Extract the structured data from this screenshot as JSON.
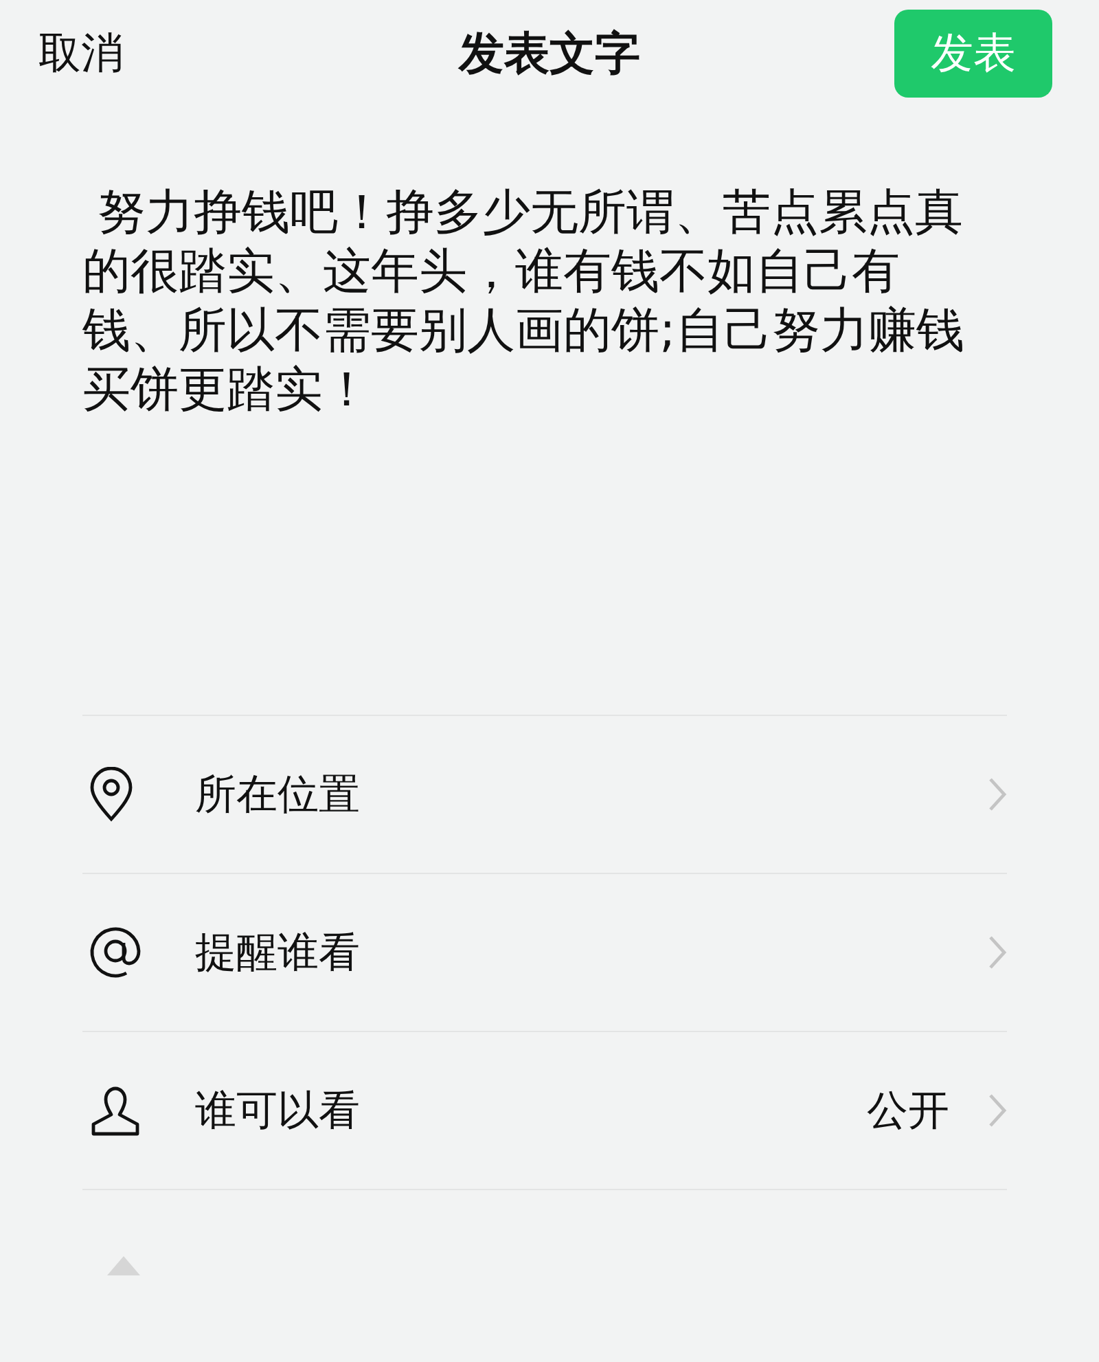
{
  "header": {
    "cancel": "取消",
    "title": "发表文字",
    "publish": "发表"
  },
  "post": {
    "text": " 努力挣钱吧！挣多少无所谓、苦点累点真的很踏实、这年头，谁有钱不如自己有钱、所以不需要别人画的饼;自己努力赚钱买饼更踏实！"
  },
  "options": [
    {
      "kind": "location",
      "label": "所在位置"
    },
    {
      "kind": "mention",
      "label": "提醒谁看"
    },
    {
      "kind": "visibility",
      "label": "谁可以看",
      "value": "公开"
    }
  ]
}
